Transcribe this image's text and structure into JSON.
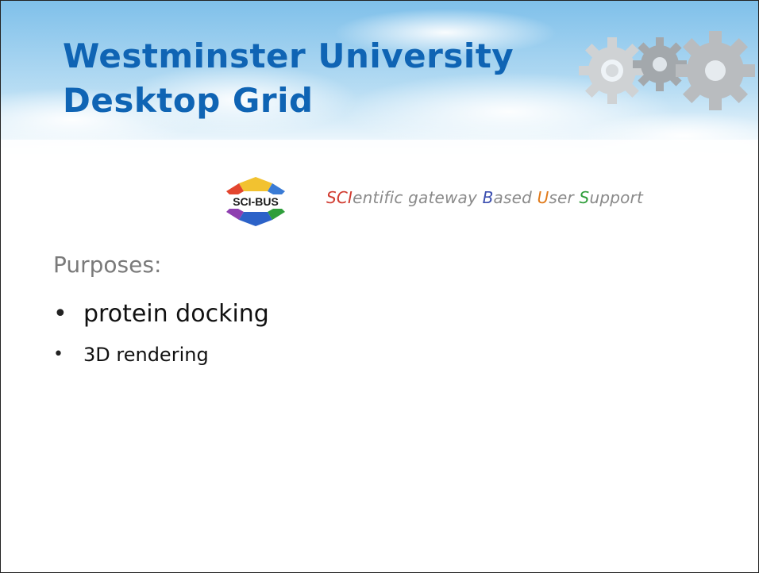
{
  "slide": {
    "title_line1": "Westminster University",
    "title_line2": "Desktop Grid",
    "logo": {
      "text": "SCI-BUS"
    },
    "tagline": {
      "p1": "SCI",
      "p2": "entific gateway ",
      "p3": "B",
      "p4": "ased ",
      "p5": "U",
      "p6": "ser ",
      "p7": "S",
      "p8": "upport"
    },
    "purposes_heading": "Purposes:",
    "bullets": [
      "protein docking",
      "3D rendering"
    ]
  },
  "colors": {
    "title": "#0f64b4",
    "sky": "#a9d3ef",
    "gear": "#b9bcbf",
    "tagline_sci": "#d13c31",
    "tagline_b": "#3c4fb0",
    "tagline_u": "#e07a1a",
    "tagline_s": "#2f9e3b"
  },
  "icons": [
    "gear-icon",
    "sci-bus-logo"
  ]
}
